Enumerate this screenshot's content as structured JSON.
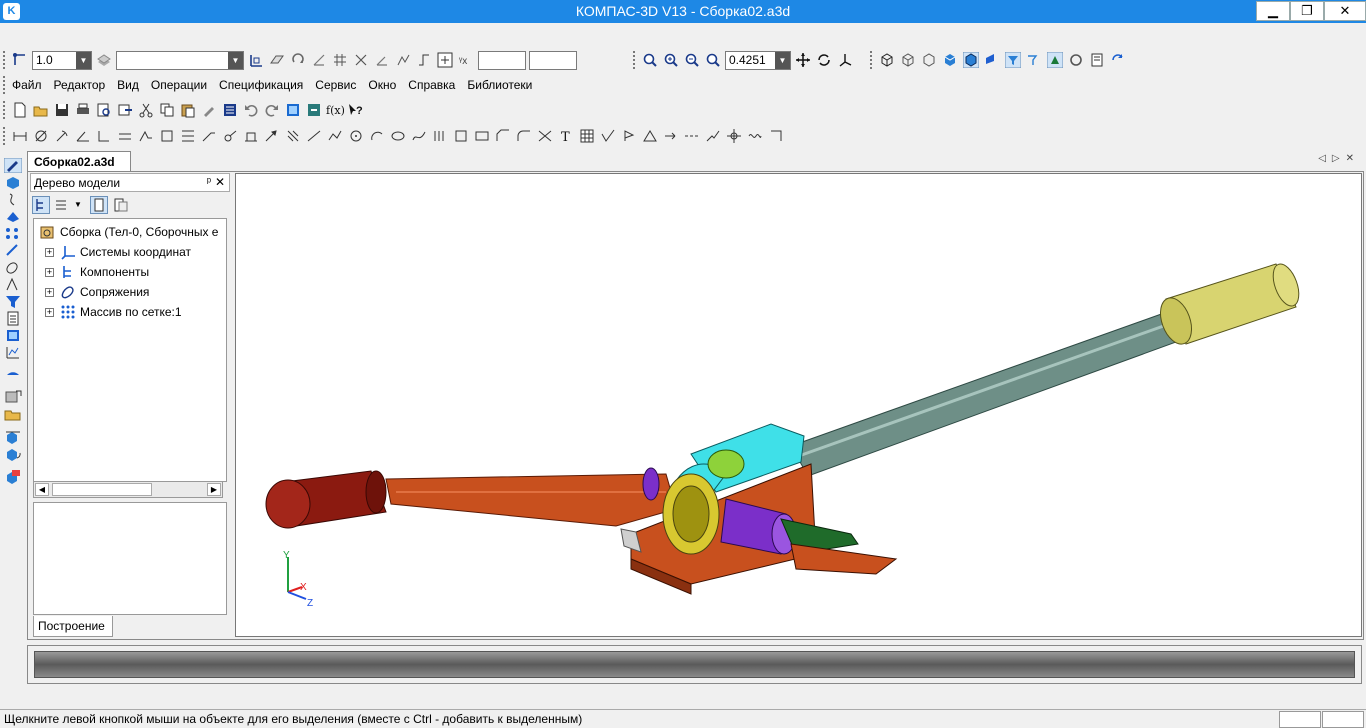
{
  "window": {
    "title": "КОМПАС-3D V13 - Сборка02.a3d",
    "app_icon": "K",
    "minimize": "▁",
    "maximize": "❐",
    "close": "✕"
  },
  "toolbar": {
    "line_width": "1.0",
    "zoom_value": "0.4251"
  },
  "menu": [
    "Файл",
    "Редактор",
    "Вид",
    "Операции",
    "Спецификация",
    "Сервис",
    "Окно",
    "Справка",
    "Библиотеки"
  ],
  "document_tab": "Сборка02.a3d",
  "tree_panel": {
    "title": "Дерево модели",
    "pin": "ᵖ",
    "close": "✕",
    "root": "Сборка (Тел-0, Сборочных е",
    "items": [
      "Системы координат",
      "Компоненты",
      "Сопряжения",
      "Массив по сетке:1"
    ],
    "tab": "Построение"
  },
  "axes": {
    "y": "Y",
    "x": "X",
    "z": "Z"
  },
  "status": {
    "hint": "Щелкните левой кнопкой мыши на объекте для его выделения (вместе с Ctrl - добавить к выделенным)"
  },
  "colors": {
    "titlebar": "#1e88e5",
    "handle_red": "#8b1a10",
    "lever_orange": "#c8501e",
    "shaft_gray": "#6e8f87",
    "grip_yellow": "#d8d470",
    "bracket_cyan": "#3fe0e8",
    "gear_yellow": "#d8c830",
    "pin_purple": "#7b2fc9",
    "jaw_green": "#1f6b2a"
  }
}
